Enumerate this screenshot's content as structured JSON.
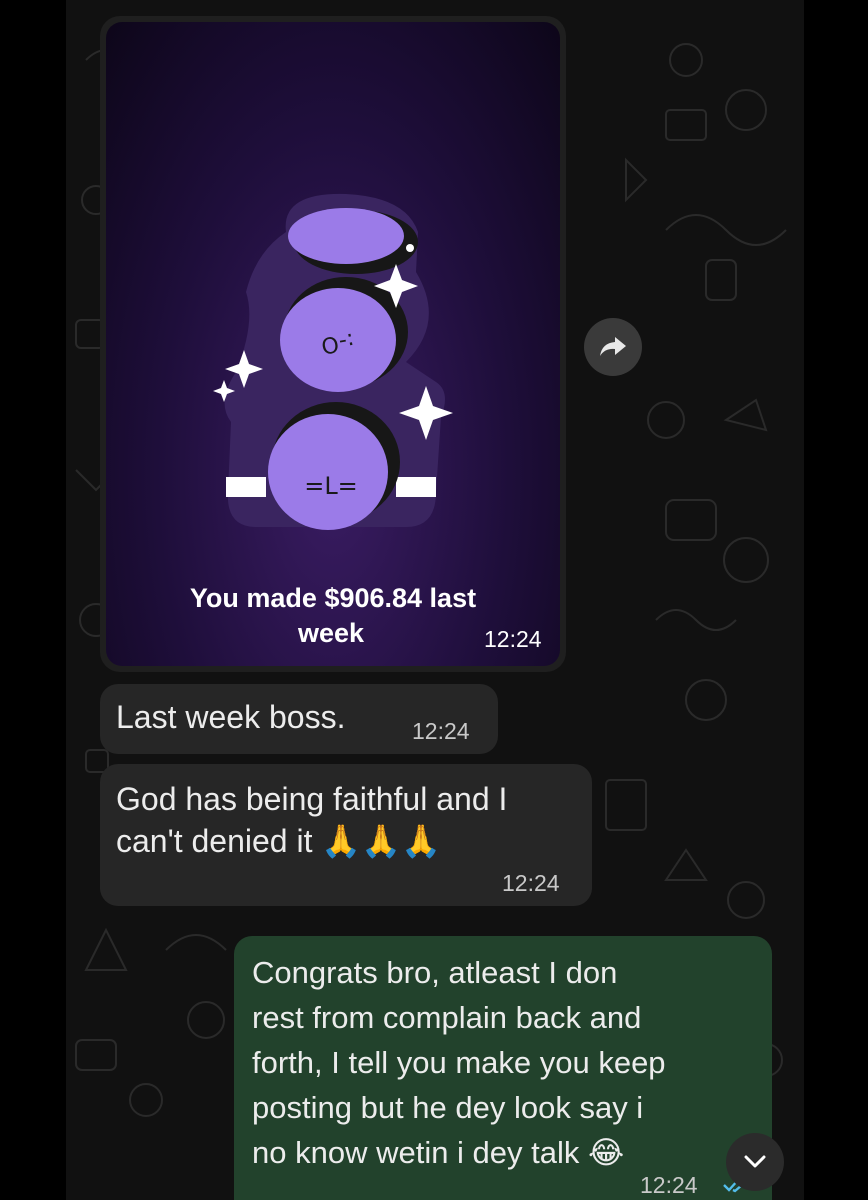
{
  "messages": [
    {
      "type": "image",
      "caption_line1": "You made $906.84 last",
      "caption_line2": "week",
      "time": "12:24"
    },
    {
      "type": "text",
      "text": "Last week boss.",
      "time": "12:24"
    },
    {
      "type": "text",
      "text": "God has being faithful and I\ncan't denied it 🙏🙏🙏",
      "time": "12:24"
    },
    {
      "type": "text",
      "text": "Congrats bro, atleast I don\nrest from complain back and\nforth, I tell you make you keep\nposting but he dey look say i\nno know wetin i dey talk 😂",
      "time": "12:24"
    }
  ],
  "icons": {
    "forward": "forward-arrow-icon",
    "scroll": "chevron-down-icon",
    "read_receipt": "double-check-icon"
  },
  "colors": {
    "incoming_bubble": "#262626",
    "outgoing_bubble": "#22422c",
    "chat_background": "#111111",
    "read_tick": "#53bdeb",
    "image_purple": "#9b7be8"
  }
}
